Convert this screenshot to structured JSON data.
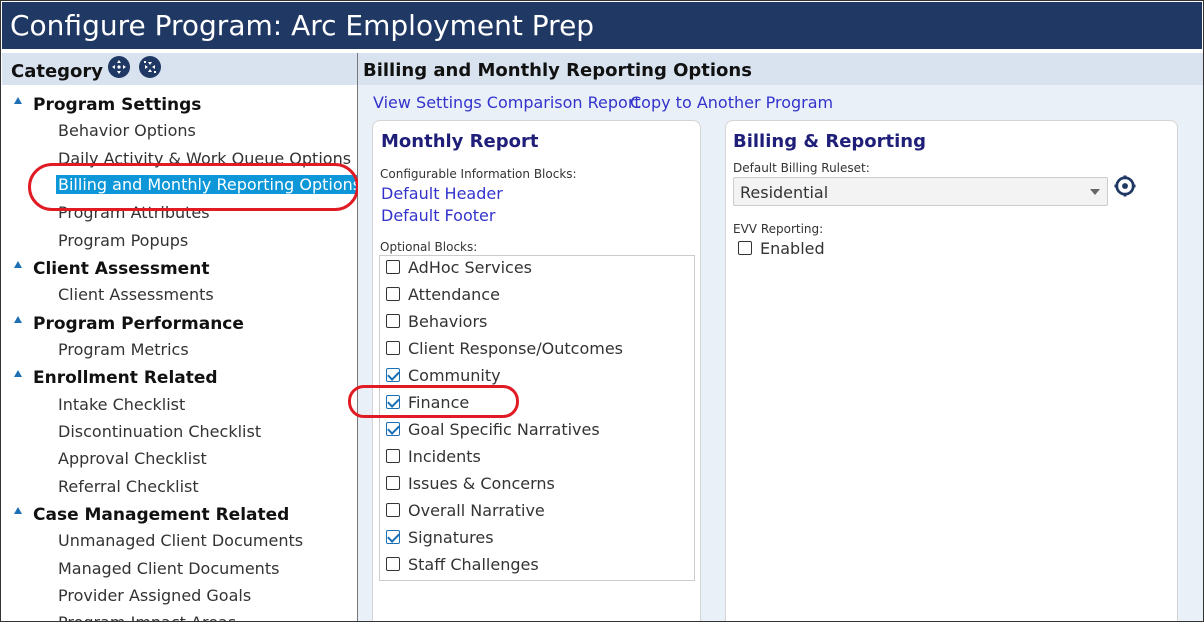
{
  "window": {
    "title": "Configure Program: Arc Employment Prep"
  },
  "sidebar": {
    "title": "Category",
    "expand_icon": "expand-all-icon",
    "collapse_icon": "collapse-all-icon",
    "groups": [
      {
        "label": "Program Settings",
        "items": [
          "Behavior Options",
          "Daily Activity & Work Queue Options",
          "Billing and Monthly Reporting Options",
          "Program Attributes",
          "Program Popups"
        ]
      },
      {
        "label": "Client Assessment",
        "items": [
          "Client Assessments"
        ]
      },
      {
        "label": "Program Performance",
        "items": [
          "Program Metrics"
        ]
      },
      {
        "label": "Enrollment Related",
        "items": [
          "Intake Checklist",
          "Discontinuation Checklist",
          "Approval Checklist",
          "Referral Checklist"
        ]
      },
      {
        "label": "Case Management Related",
        "items": [
          "Unmanaged Client Documents",
          "Managed Client Documents",
          "Provider Assigned Goals",
          "Program Impact Areas"
        ]
      }
    ],
    "selected_item": "Billing and Monthly Reporting Options"
  },
  "main": {
    "title": "Billing and Monthly Reporting Options",
    "links": [
      "View Settings Comparison Report",
      "Copy to Another Program"
    ],
    "monthly_report": {
      "title": "Monthly Report",
      "config_label": "Configurable Information Blocks:",
      "config_links": [
        "Default Header",
        "Default Footer"
      ],
      "optional_label": "Optional Blocks:",
      "optional_blocks": [
        {
          "label": "AdHoc Services",
          "checked": false
        },
        {
          "label": "Attendance",
          "checked": false
        },
        {
          "label": "Behaviors",
          "checked": false
        },
        {
          "label": "Client Response/Outcomes",
          "checked": false
        },
        {
          "label": "Community",
          "checked": true
        },
        {
          "label": "Finance",
          "checked": true
        },
        {
          "label": "Goal Specific Narratives",
          "checked": true
        },
        {
          "label": "Incidents",
          "checked": false
        },
        {
          "label": "Issues & Concerns",
          "checked": false
        },
        {
          "label": "Overall Narrative",
          "checked": false
        },
        {
          "label": "Signatures",
          "checked": true
        },
        {
          "label": "Staff Challenges",
          "checked": false
        }
      ]
    },
    "billing": {
      "title": "Billing & Reporting",
      "ruleset_label": "Default Billing Ruleset:",
      "ruleset_value": "Residential",
      "settings_icon": "gear-icon",
      "evv_label": "EVV Reporting:",
      "evv_enabled_label": "Enabled",
      "evv_enabled": false
    }
  },
  "colors": {
    "titlebar": "#1f3864",
    "selected": "#0d97d8",
    "annotation": "#e01b24",
    "link": "#3333cc"
  }
}
